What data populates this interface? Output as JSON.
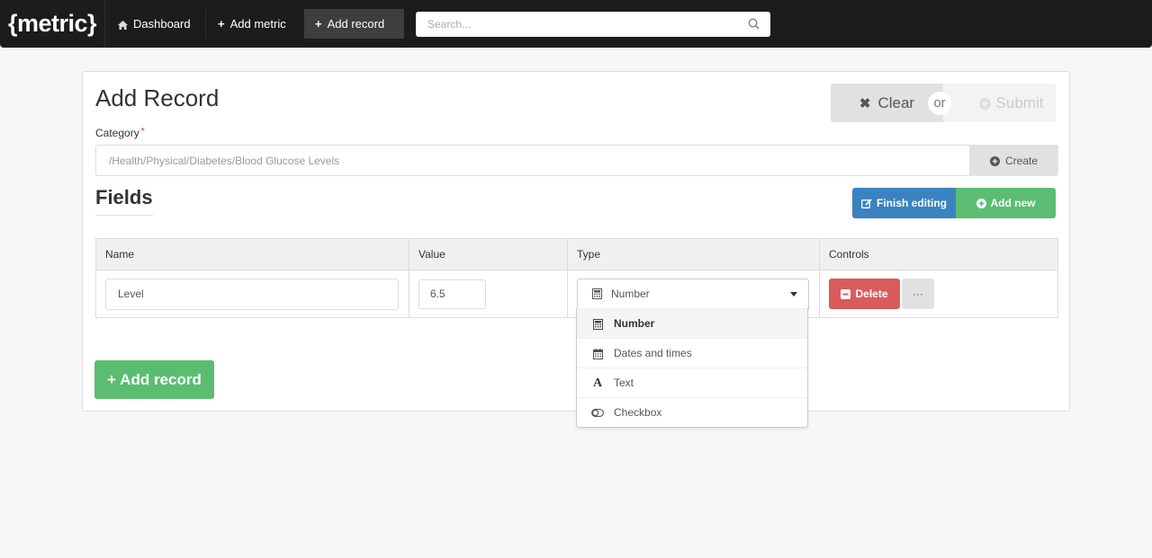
{
  "navbar": {
    "brand": "{metric}",
    "items": [
      {
        "label": "Dashboard",
        "icon": "home-icon",
        "active": false
      },
      {
        "label": "Add metric",
        "icon": "plus-icon",
        "active": false
      },
      {
        "label": "Add record",
        "icon": "plus-icon",
        "active": true
      }
    ],
    "search": {
      "placeholder": "Search...",
      "value": ""
    }
  },
  "page": {
    "title": "Add Record",
    "actions": {
      "clear_label": "Clear",
      "or_label": "or",
      "submit_label": "Submit"
    },
    "category": {
      "label": "Category",
      "required_mark": "*",
      "value": "/Health/Physical/Diabetes/Blood Glucose Levels",
      "create_label": "Create"
    },
    "fields": {
      "title": "Fields",
      "finish_editing_label": "Finish editing",
      "add_new_label": "Add new",
      "columns": [
        "Name",
        "Value",
        "Type",
        "Controls"
      ],
      "rows": [
        {
          "name": "Level",
          "value": "6.5",
          "type": "Number",
          "delete_label": "Delete",
          "more_label": "···"
        }
      ],
      "type_options": [
        {
          "label": "Number",
          "icon": "calculator-icon",
          "selected": true
        },
        {
          "label": "Dates and times",
          "icon": "calendar-icon",
          "selected": false
        },
        {
          "label": "Text",
          "icon": "font-icon",
          "selected": false
        },
        {
          "label": "Checkbox",
          "icon": "toggle-icon",
          "selected": false
        }
      ]
    },
    "add_record_label": "Add record"
  },
  "colors": {
    "navbar_bg": "#1b1c1d",
    "primary_blue": "#3b83c0",
    "success_green": "#5bbd72",
    "danger_red": "#d95c5c",
    "required_red": "#db2828"
  }
}
